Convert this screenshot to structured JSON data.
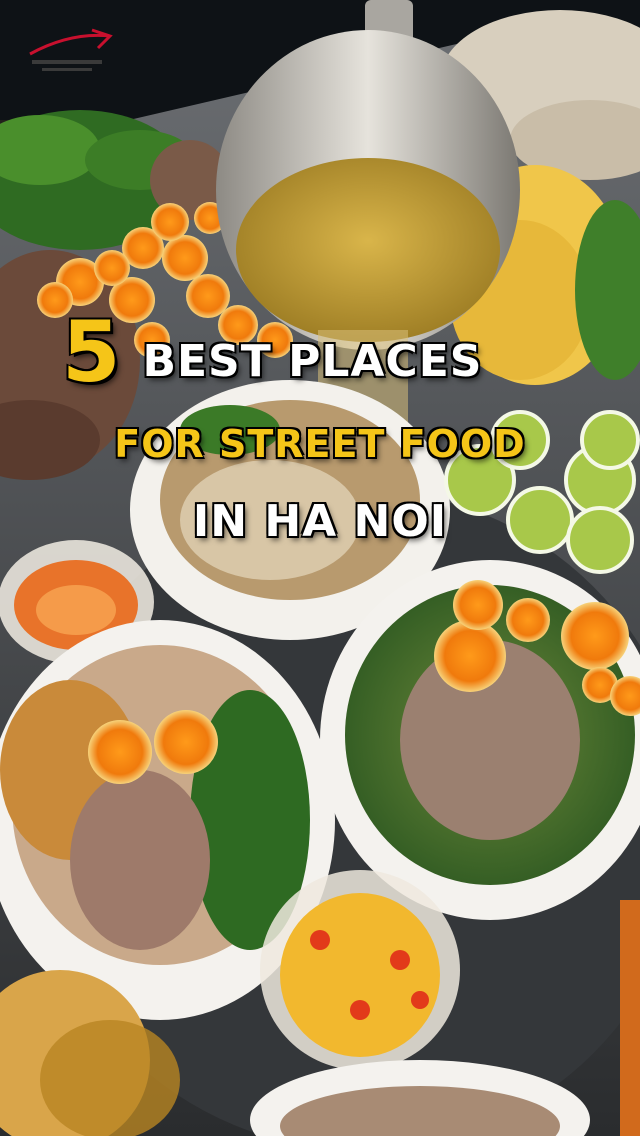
{
  "title": {
    "number": "5",
    "line1": "BEST PLACES",
    "line2": "FOR STREET FOOD",
    "line3": "IN HA NOI"
  },
  "colors": {
    "accent_yellow": "#f5c518",
    "text_white": "#ffffff",
    "logo_red": "#c8102e"
  },
  "icons": [
    "brand-logo"
  ]
}
